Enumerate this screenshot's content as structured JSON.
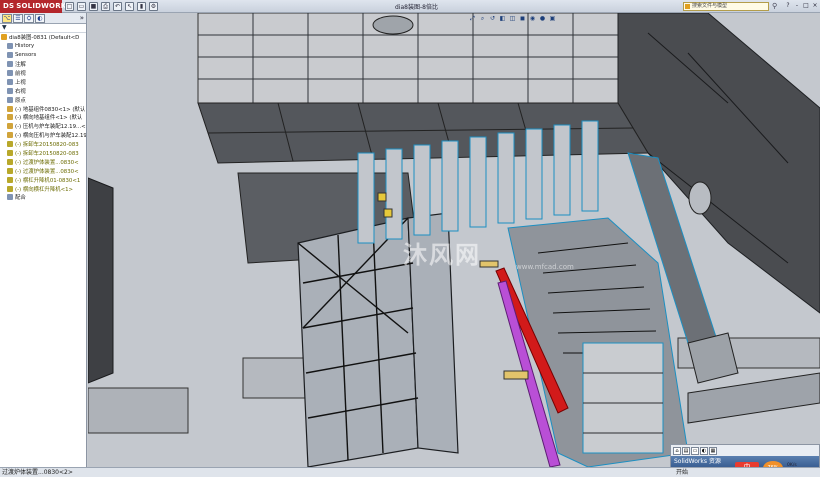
{
  "app": {
    "logo_text": "SOLIDWORKS",
    "document_title": "dia8装图-8倍比",
    "search_placeholder": "搜索文件与模型"
  },
  "title_toolbar": [
    "new-icon",
    "open-icon",
    "save-icon",
    "print-icon",
    "undo-icon",
    "select-icon",
    "rebuild-icon",
    "options-icon"
  ],
  "window_buttons": [
    "?",
    "-",
    "□",
    "×"
  ],
  "feature_manager": {
    "tabs": [
      "feature-tree",
      "property",
      "config",
      "display"
    ],
    "filter_label": "▼",
    "expand_label": "»",
    "items": [
      {
        "label": "dia8装图-0831 (Default<D",
        "style": "assembly"
      },
      {
        "label": "History",
        "style": "plain"
      },
      {
        "label": "Sensors",
        "style": "plain"
      },
      {
        "label": "注解",
        "style": "plain"
      },
      {
        "label": "前视",
        "style": "plain"
      },
      {
        "label": "上视",
        "style": "plain"
      },
      {
        "label": "右视",
        "style": "plain"
      },
      {
        "label": "原点",
        "style": "plain"
      },
      {
        "label": "(-) 地基组件0830<1> (默认",
        "style": "part"
      },
      {
        "label": "(-) 横向地基组件<1> (默认",
        "style": "part"
      },
      {
        "label": "(-) 压机与炉车装配12.19...<",
        "style": "part"
      },
      {
        "label": "(-) 横向压机与炉车装配12.19",
        "style": "part"
      },
      {
        "label": "(-) 拆卸车20150820-083",
        "style": "olive"
      },
      {
        "label": "(-) 拆卸车20150820-083",
        "style": "olive"
      },
      {
        "label": "(-) 过渡炉体装置...0830<",
        "style": "olive"
      },
      {
        "label": "(-) 过渡炉体装置...0830<",
        "style": "olive"
      },
      {
        "label": "(-) 横杠升降机01-0830<1",
        "style": "olive"
      },
      {
        "label": "(-) 横向横杠升降机<1>",
        "style": "olive"
      },
      {
        "label": "配合",
        "style": "plain"
      }
    ]
  },
  "viewport": {
    "hud_icons": [
      "zoom-fit-icon",
      "zoom-area-icon",
      "previous-view-icon",
      "section-view-icon",
      "view-orientation-icon",
      "display-style-icon",
      "hide-show-icon",
      "appearance-icon",
      "scene-icon"
    ],
    "watermark": "沐风网",
    "watermark_url": "www.mfcad.com"
  },
  "task_pane": {
    "title": "SolidWorks 资源",
    "start_label": "开始"
  },
  "tray": {
    "ime_label": "中",
    "cpu_percent": "76%",
    "net_up": "0K/s",
    "net_down": "0.1K/s"
  },
  "statusbar": {
    "text": "过渡炉体装置...0830<2>"
  }
}
